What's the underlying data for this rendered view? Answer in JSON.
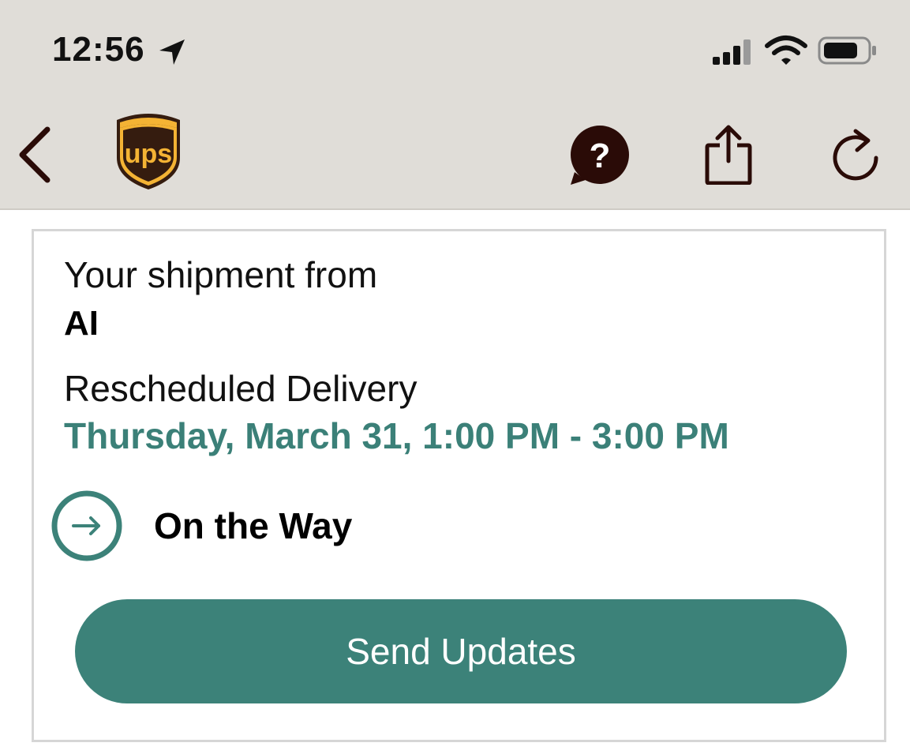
{
  "status_bar": {
    "time": "12:56",
    "icons": [
      "location-arrow-icon",
      "cellular-signal-icon",
      "wifi-icon",
      "battery-icon"
    ]
  },
  "nav": {
    "logo_text": "ups",
    "icons": [
      "back-chevron-icon",
      "help-icon",
      "share-icon",
      "refresh-icon"
    ],
    "brand_colors": {
      "brown": "#3a1f12",
      "gold": "#f4b334"
    }
  },
  "shipment": {
    "from_label": "Your shipment from",
    "sender": "AI",
    "delivery_label": "Rescheduled Delivery",
    "delivery_window": "Thursday, March 31, 1:00 PM - 3:00 PM",
    "status": "On the Way",
    "button_label": "Send Updates"
  },
  "colors": {
    "accent": "#3c8279",
    "topbar_bg": "#e0ddd8",
    "icon_dark": "#2a0b07"
  }
}
